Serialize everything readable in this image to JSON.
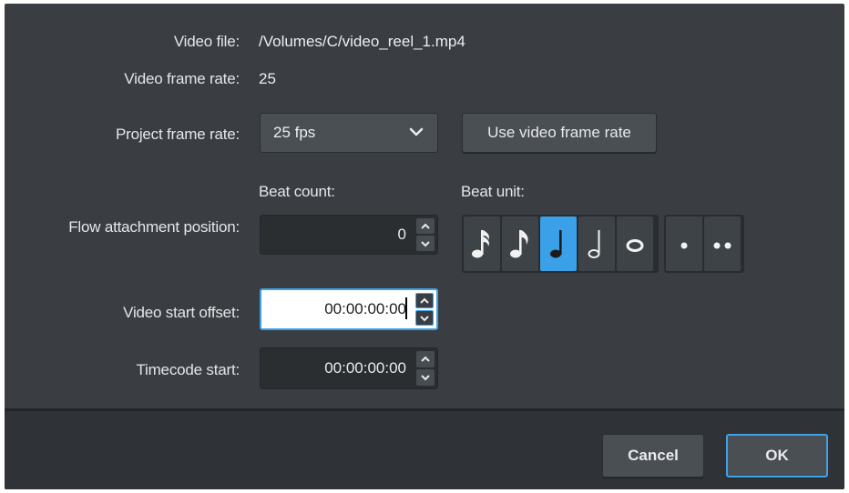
{
  "video_file": {
    "label": "Video file:",
    "value": "/Volumes/C/video_reel_1.mp4"
  },
  "video_frame_rate": {
    "label": "Video frame rate:",
    "value": "25"
  },
  "project_frame_rate": {
    "label": "Project frame rate:",
    "selected": "25 fps",
    "use_video_button": "Use video frame rate"
  },
  "flow_attachment": {
    "label": "Flow attachment position:",
    "beat_count_label": "Beat count:",
    "beat_count_value": "0",
    "beat_unit_label": "Beat unit:",
    "beat_units": [
      {
        "icon": "sixteenth-note-icon",
        "selected": false
      },
      {
        "icon": "eighth-note-icon",
        "selected": false
      },
      {
        "icon": "quarter-note-icon",
        "selected": true
      },
      {
        "icon": "half-note-icon",
        "selected": false
      },
      {
        "icon": "whole-note-icon",
        "selected": false
      }
    ],
    "dot_units": [
      {
        "icon": "single-dot-icon",
        "selected": false
      },
      {
        "icon": "double-dot-icon",
        "selected": false
      }
    ]
  },
  "video_start_offset": {
    "label": "Video start offset:",
    "value": "00:00:00:00"
  },
  "timecode_start": {
    "label": "Timecode start:",
    "value": "00:00:00:00"
  },
  "footer": {
    "cancel_label": "Cancel",
    "ok_label": "OK"
  },
  "colors": {
    "accent": "#3fa2e6",
    "panel": "#3a3e42",
    "footer": "#2f3236"
  }
}
